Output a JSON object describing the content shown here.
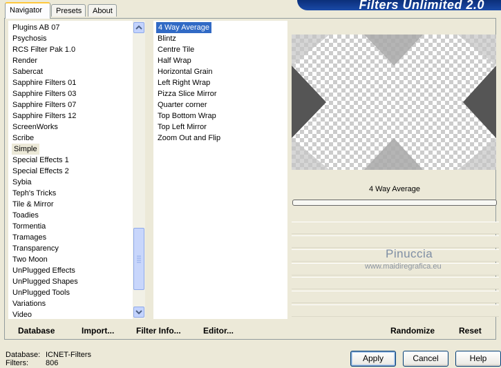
{
  "app": {
    "title": "Filters Unlimited 2.0"
  },
  "tabs": [
    {
      "label": "Navigator",
      "active": true
    },
    {
      "label": "Presets",
      "active": false
    },
    {
      "label": "About",
      "active": false
    }
  ],
  "categories": {
    "items": [
      "Plugins AB 07",
      "Psychosis",
      "RCS Filter Pak 1.0",
      "Render",
      "Sabercat",
      "Sapphire Filters 01",
      "Sapphire Filters 03",
      "Sapphire Filters 07",
      "Sapphire Filters 12",
      "ScreenWorks",
      "Scribe",
      "Simple",
      "Special Effects 1",
      "Special Effects 2",
      "Sybia",
      "Teph's Tricks",
      "Tile & Mirror",
      "Toadies",
      "Tormentia",
      "Tramages",
      "Transparency",
      "Two Moon",
      "UnPlugged Effects",
      "UnPlugged Shapes",
      "UnPlugged Tools",
      "Variations",
      "Video"
    ],
    "selected": "Simple"
  },
  "filters": {
    "items": [
      "4 Way Average",
      "Blintz",
      "Centre Tile",
      "Half Wrap",
      "Horizontal Grain",
      "Left Right Wrap",
      "Pizza Slice Mirror",
      "Quarter corner",
      "Top Bottom Wrap",
      "Top Left Mirror",
      "Zoom Out and Flip"
    ],
    "selected": "4 Way Average"
  },
  "preview": {
    "filter_name": "4 Way Average",
    "progress": 0,
    "watermark_name": "Pinuccia",
    "watermark_url": "www.maidiregrafica.eu"
  },
  "buttons": {
    "database": "Database",
    "import": "Import...",
    "filter_info": "Filter Info...",
    "editor": "Editor...",
    "randomize": "Randomize",
    "reset": "Reset",
    "apply": "Apply",
    "cancel": "Cancel",
    "help": "Help"
  },
  "status": {
    "database_label": "Database:",
    "database_value": "ICNET-Filters",
    "filters_label": "Filters:",
    "filters_value": "806"
  },
  "colors": {
    "selection": "#316AC5",
    "title_bar": "#0B2F7A",
    "window_bg": "#ECE9D8"
  }
}
